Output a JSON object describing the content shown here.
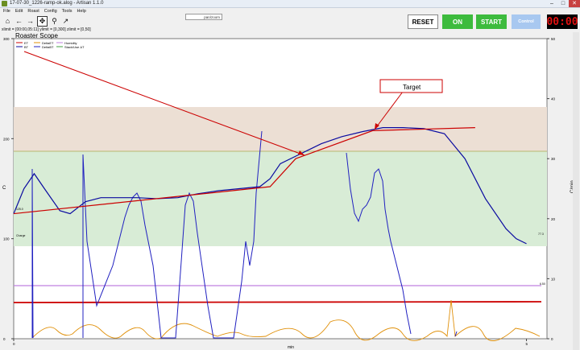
{
  "window": {
    "title": "17-07-30_1226-ramp-ok.alog - Artisan 1.1.0",
    "buttons": [
      "–",
      "□",
      "✕"
    ]
  },
  "menu": [
    "File",
    "Edit",
    "Roast",
    "Config",
    "Tools",
    "Help"
  ],
  "toolbar": {
    "icons": [
      "home-icon",
      "back-icon",
      "forward-icon",
      "pan-icon",
      "zoom-icon",
      "lines-icon"
    ],
    "search_text": "pan/zoom"
  },
  "coord_readout": "xlimit = [00:00,05:11]  ylimit = [0,300]  zlimit = [0,50]",
  "controls": {
    "reset": "RESET",
    "on": "ON",
    "start": "START",
    "control": "Control",
    "timer": "00:00"
  },
  "chart": {
    "title": "Roaster Scope",
    "ylabel": "C",
    "y2label": "C/min",
    "xlabel": "min",
    "y_ticks": [
      "0",
      "100",
      "200",
      "300"
    ],
    "y2_ticks": [
      "0",
      "10",
      "20",
      "30",
      "40",
      "50"
    ],
    "x_ticks": [
      "0",
      "5"
    ],
    "legend": [
      "ET",
      "BT",
      "DeltaET",
      "DeltaBT",
      "Humidity",
      "Stack/Use ΔT"
    ],
    "annotation_target": "Target",
    "labels": {
      "bt_start": "125.0",
      "bt_start2": "Charge",
      "end_top": "77.3",
      "end_bot": "6.50"
    },
    "colors": {
      "et": "#cc0000",
      "bt": "#0a0aa0",
      "delta": "#e0900a",
      "humidity": "#c080e0",
      "target": "#cc0000"
    }
  },
  "chart_data": {
    "type": "line",
    "xlim": [
      0,
      5.2
    ],
    "ylim": [
      0,
      300
    ],
    "y2lim": [
      0,
      50
    ],
    "series": [
      {
        "name": "BT",
        "x": [
          0,
          0.1,
          0.2,
          0.3,
          0.45,
          0.55,
          0.7,
          0.85,
          1.0,
          1.2,
          1.4,
          1.6,
          1.8,
          2.0,
          2.2,
          2.4,
          2.5,
          2.6,
          2.8,
          3.0,
          3.2,
          3.4,
          3.6,
          3.8,
          4.0,
          4.2,
          4.4,
          4.6,
          4.8,
          4.9,
          5.0
        ],
        "y": [
          125,
          150,
          165,
          150,
          128,
          125,
          137,
          141,
          141,
          141,
          140,
          141,
          145,
          148,
          150,
          152,
          160,
          175,
          185,
          195,
          202,
          207,
          211,
          211,
          210,
          205,
          180,
          140,
          110,
          100,
          95
        ]
      },
      {
        "name": "ET",
        "x": [
          0,
          5.0
        ],
        "y": [
          35,
          35
        ]
      },
      {
        "name": "Humidity",
        "x": [
          0,
          5.0
        ],
        "y": [
          52,
          52
        ]
      },
      {
        "name": "Target",
        "x": [
          0,
          2.5,
          2.75,
          3.5,
          4.5
        ],
        "y": [
          125,
          152,
          180,
          208,
          211
        ]
      }
    ]
  }
}
